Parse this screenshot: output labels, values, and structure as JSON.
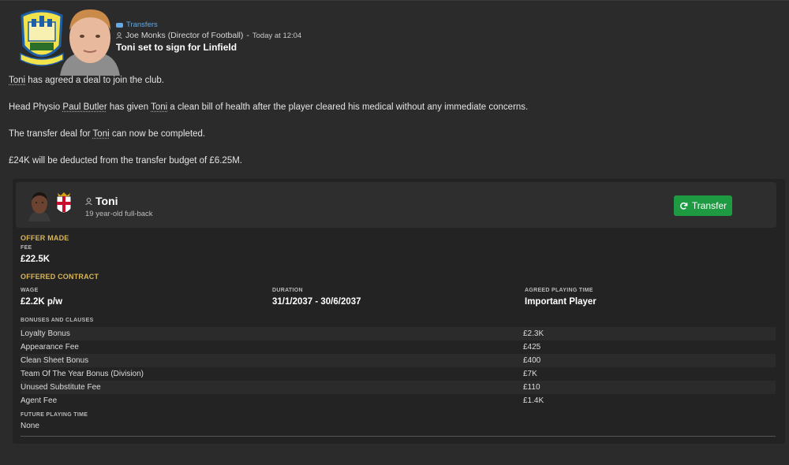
{
  "header": {
    "tag": "Transfers",
    "sender": "Joe Monks (Director of Football)",
    "separator": "-",
    "time": "Today at 12:04",
    "headline": "Toni set to sign for Linfield"
  },
  "body": {
    "p1_name": "Toni",
    "p1_rest": " has agreed a deal to join the club.",
    "p2_a": "Head Physio ",
    "p2_physio": "Paul Butler",
    "p2_b": " has given ",
    "p2_player": "Toni",
    "p2_c": " a clean bill of health after the player cleared his medical without any immediate concerns.",
    "p3_a": "The transfer deal for ",
    "p3_player": "Toni",
    "p3_b": " can now be completed.",
    "p4": "£24K will be deducted from the transfer budget of £6.25M."
  },
  "player": {
    "name": "Toni",
    "description": "19 year-old full-back",
    "transfer_label": "Transfer"
  },
  "offer": {
    "title": "OFFER MADE",
    "fee_label": "FEE",
    "fee_value": "£22.5K"
  },
  "contract": {
    "title": "OFFERED CONTRACT",
    "wage_label": "WAGE",
    "wage_value": "£2.2K p/w",
    "duration_label": "DURATION",
    "duration_value": "31/1/2037 - 30/6/2037",
    "playing_time_label": "AGREED PLAYING TIME",
    "playing_time_value": "Important Player",
    "bonuses_label": "BONUSES AND CLAUSES",
    "bonuses": [
      {
        "name": "Loyalty Bonus",
        "value": "£2.3K"
      },
      {
        "name": "Appearance Fee",
        "value": "£425"
      },
      {
        "name": "Clean Sheet Bonus",
        "value": "£400"
      },
      {
        "name": "Team Of The Year Bonus (Division)",
        "value": "£7K"
      },
      {
        "name": "Unused Substitute Fee",
        "value": "£110"
      },
      {
        "name": "Agent Fee",
        "value": "£1.4K"
      }
    ],
    "future_label": "FUTURE PLAYING TIME",
    "future_value": "None"
  },
  "colors": {
    "background": "#2b2b2b",
    "panel": "#232323",
    "accent_gold": "#d7b65c",
    "tag_blue": "#63a9e6",
    "button_green": "#1e9a43"
  },
  "icons": [
    "transfers-tag-icon",
    "person-icon",
    "refresh-icon"
  ]
}
